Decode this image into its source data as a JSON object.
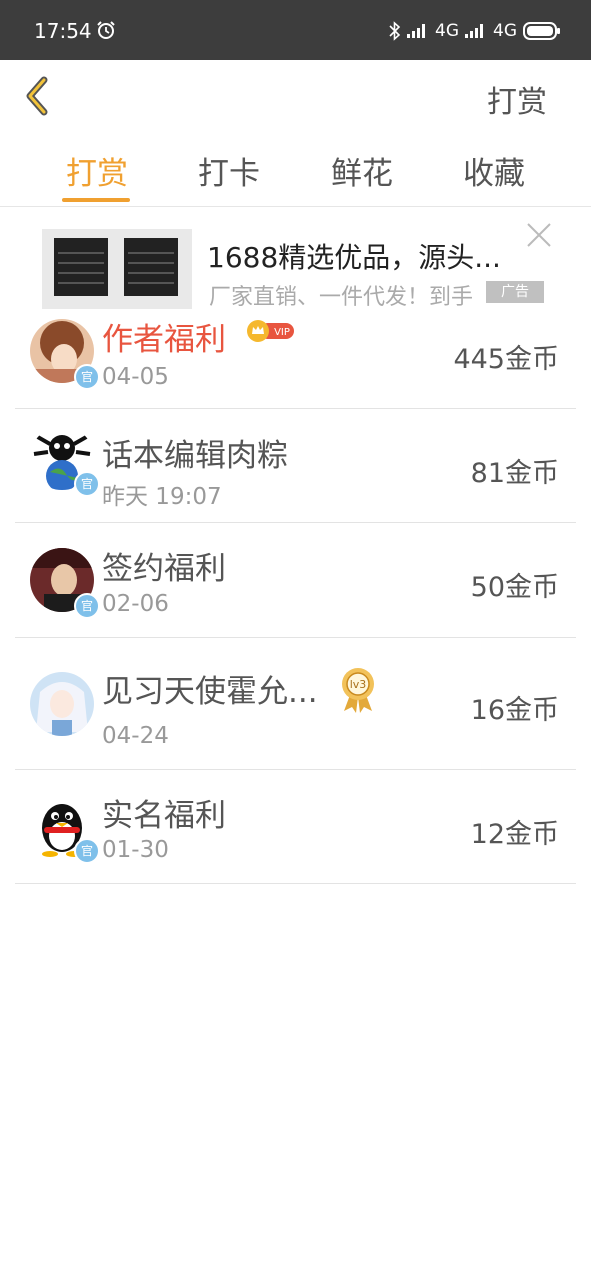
{
  "status_bar": {
    "time": "17:54",
    "network1": "4G",
    "network2": "4G",
    "icons": [
      "alarm-icon",
      "bluetooth-icon",
      "signal-icon",
      "battery-icon"
    ]
  },
  "header": {
    "back_icon": "chevron-left-icon",
    "action_label": "打赏"
  },
  "tabs": [
    {
      "label": "打赏",
      "active": true
    },
    {
      "label": "打卡",
      "active": false
    },
    {
      "label": "鲜花",
      "active": false
    },
    {
      "label": "收藏",
      "active": false
    }
  ],
  "ad": {
    "title": "1688精选优品，源头...",
    "subtitle": "厂家直销、一件代发！到手",
    "badge": "广告",
    "close_icon": "close-icon"
  },
  "rewards": [
    {
      "name": "作者福利",
      "date": "04-05",
      "coins": "445金币",
      "highlight": true,
      "vip_label": "VIP",
      "official": "官"
    },
    {
      "name": "话本编辑肉粽",
      "date": "昨天 19:07",
      "coins": "81金币",
      "highlight": false,
      "official": "官"
    },
    {
      "name": "签约福利",
      "date": "02-06",
      "coins": "50金币",
      "highlight": false,
      "official": "官"
    },
    {
      "name": "见习天使霍允...",
      "date": "04-24",
      "coins": "16金币",
      "highlight": false,
      "level_label": "lv3"
    },
    {
      "name": "实名福利",
      "date": "01-30",
      "coins": "12金币",
      "highlight": false,
      "official": "官"
    }
  ],
  "colors": {
    "accent": "#f0a030",
    "highlight_name": "#e8553f",
    "status_bar": "#3d3d3d"
  }
}
